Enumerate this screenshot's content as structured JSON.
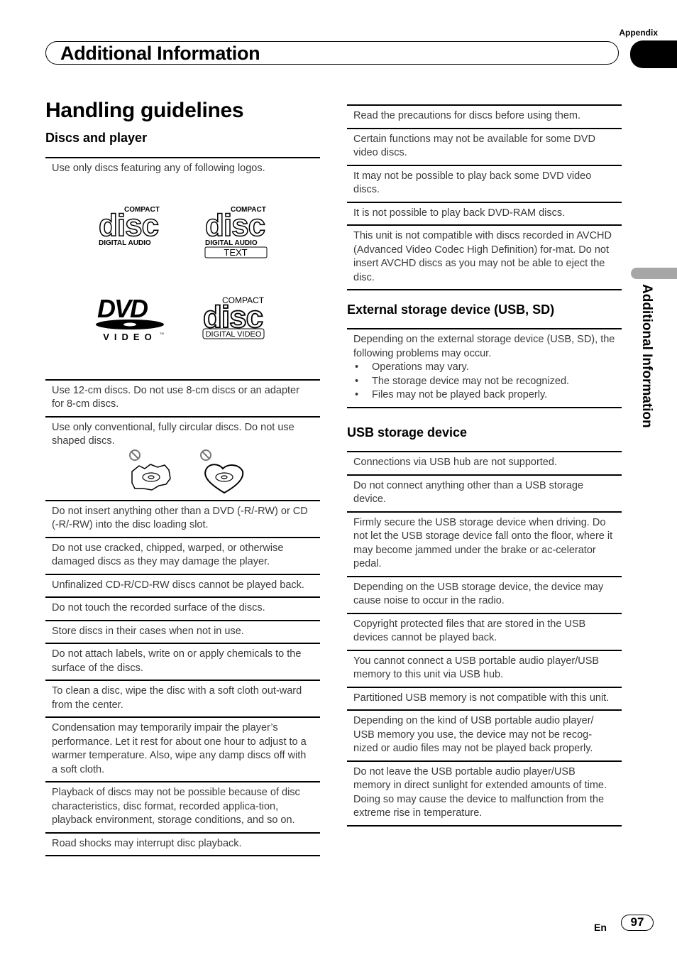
{
  "header": {
    "appendix_label": "Appendix",
    "section_title": "Additional Information",
    "side_tab_label": "Additional Information"
  },
  "page": {
    "title": "Handling guidelines",
    "language": "En",
    "page_number": "97"
  },
  "discs_and_player": {
    "heading": "Discs and player",
    "intro": "Use only discs featuring any of following logos.",
    "logos": [
      {
        "name": "compact-disc-digital-audio",
        "top": "COMPACT",
        "main": "disc",
        "bottom": "DIGITAL AUDIO"
      },
      {
        "name": "compact-disc-digital-audio-text",
        "top": "COMPACT",
        "main": "disc",
        "bottom": "DIGITAL AUDIO",
        "extra": "TEXT"
      },
      {
        "name": "dvd-video",
        "main": "DVD",
        "bottom": "VIDEO",
        "tm": "TM"
      },
      {
        "name": "compact-disc-digital-video",
        "top": "COMPACT",
        "main": "disc",
        "bottom": "DIGITAL VIDEO"
      }
    ],
    "items": [
      "Use 12-cm discs. Do not use 8-cm discs or an adapter for 8-cm discs.",
      "Use only conventional, fully circular discs. Do not use shaped discs.",
      "Do not insert anything other than a DVD (-R/-RW) or CD (-R/-RW) into the disc loading slot.",
      "Do not use cracked, chipped, warped, or otherwise damaged discs as they may damage the player.",
      "Unfinalized CD-R/CD-RW discs cannot be played back.",
      "Do not touch the recorded surface of the discs.",
      "Store discs in their cases when not in use.",
      "Do not attach labels, write on or apply chemicals to the surface of the discs.",
      "To clean a disc, wipe the disc with a soft cloth out-ward from the center.",
      "Condensation may temporarily impair the player’s performance. Let it rest for about one hour to adjust to a warmer temperature. Also, wipe any damp discs off with a soft cloth.",
      "Playback of discs may not be possible because of disc characteristics, disc format, recorded applica-tion, playback environment, storage conditions, and so on.",
      "Road shocks may interrupt disc playback."
    ],
    "right_items": [
      "Read the precautions for discs before using them.",
      "Certain functions may not be available for some DVD video discs.",
      "It may not be possible to play back some DVD video discs.",
      "It is not possible to play back DVD-RAM discs.",
      "This unit is not compatible with discs recorded in AVCHD (Advanced Video Codec High Definition) for-mat. Do not insert AVCHD discs as you may not be able to eject the disc."
    ]
  },
  "external_storage": {
    "heading": "External storage device (USB, SD)",
    "intro": "Depending on the external storage device (USB, SD), the following problems may occur.",
    "bullets": [
      "Operations may vary.",
      "The storage device may not be recognized.",
      "Files may not be played back properly."
    ]
  },
  "usb_storage": {
    "heading": "USB storage device",
    "items": [
      "Connections via USB hub are not supported.",
      "Do not connect anything other than a USB storage device.",
      "Firmly secure the USB storage device when driving. Do not let the USB storage device fall onto the floor, where it may become jammed under the brake or ac-celerator pedal.",
      "Depending on the USB storage device, the device may cause noise to occur in the radio.",
      "Copyright protected files that are stored in the USB devices cannot be played back.",
      "You cannot connect a USB portable audio player/USB memory to this unit via USB hub.",
      "Partitioned USB memory is not compatible with this unit.",
      "Depending on the kind of USB portable audio player/ USB memory you use, the device may not be recog-nized or audio files may not be played back properly.",
      "Do not leave the USB portable audio player/USB memory in direct sunlight for extended amounts of time. Doing so may cause the device to malfunction from the extreme rise in temperature."
    ]
  }
}
